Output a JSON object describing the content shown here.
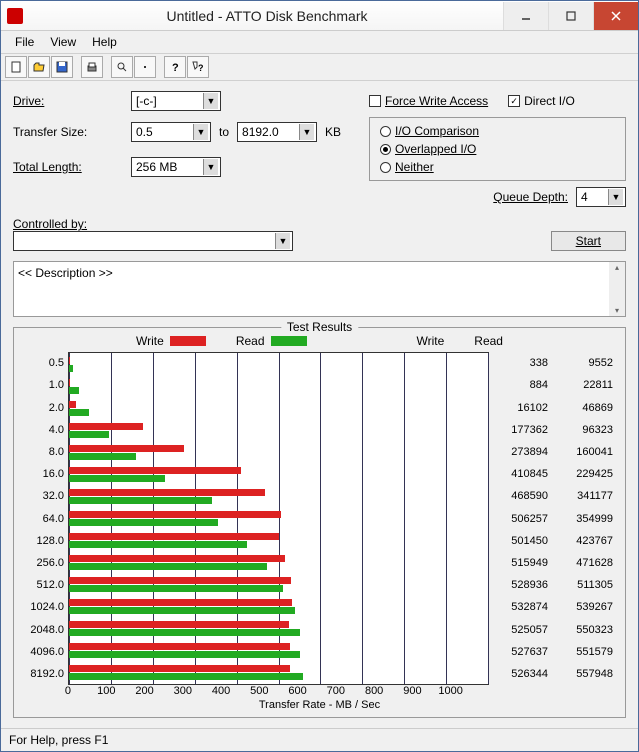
{
  "window": {
    "title": "Untitled - ATTO Disk Benchmark"
  },
  "menu": {
    "file": "File",
    "view": "View",
    "help": "Help"
  },
  "labels": {
    "drive": "Drive:",
    "transfer_size": "Transfer Size:",
    "to": "to",
    "kb": "KB",
    "total_length": "Total Length:",
    "force_write": "Force Write Access",
    "direct_io": "Direct I/O",
    "io_comparison": "I/O Comparison",
    "overlapped_io": "Overlapped I/O",
    "neither": "Neither",
    "queue_depth": "Queue Depth:",
    "controlled_by": "Controlled by:",
    "start": "Start",
    "description": "<< Description >>",
    "test_results": "Test Results",
    "write": "Write",
    "read": "Read",
    "transfer_rate": "Transfer Rate - MB / Sec",
    "status": "For Help, press F1"
  },
  "values": {
    "drive": "[-c-]",
    "ts_from": "0.5",
    "ts_to": "8192.0",
    "total_length": "256 MB",
    "queue_depth": "4",
    "controlled_by": "",
    "direct_io_checked": true,
    "force_write_checked": false,
    "io_mode": "overlapped"
  },
  "chart_data": {
    "type": "bar",
    "xlabel": "Transfer Rate - MB / Sec",
    "xlim": [
      0,
      1000
    ],
    "xticks": [
      0,
      100,
      200,
      300,
      400,
      500,
      600,
      700,
      800,
      900,
      1000
    ],
    "categories": [
      "0.5",
      "1.0",
      "2.0",
      "4.0",
      "8.0",
      "16.0",
      "32.0",
      "64.0",
      "128.0",
      "256.0",
      "512.0",
      "1024.0",
      "2048.0",
      "4096.0",
      "8192.0"
    ],
    "series": [
      {
        "name": "Write",
        "values": [
          338,
          884,
          16102,
          177362,
          273894,
          410845,
          468590,
          506257,
          501450,
          515949,
          528936,
          532874,
          525057,
          527637,
          526344
        ]
      },
      {
        "name": "Read",
        "values": [
          9552,
          22811,
          46869,
          96323,
          160041,
          229425,
          341177,
          354999,
          423767,
          471628,
          511305,
          539267,
          550323,
          551579,
          557948
        ]
      }
    ]
  }
}
